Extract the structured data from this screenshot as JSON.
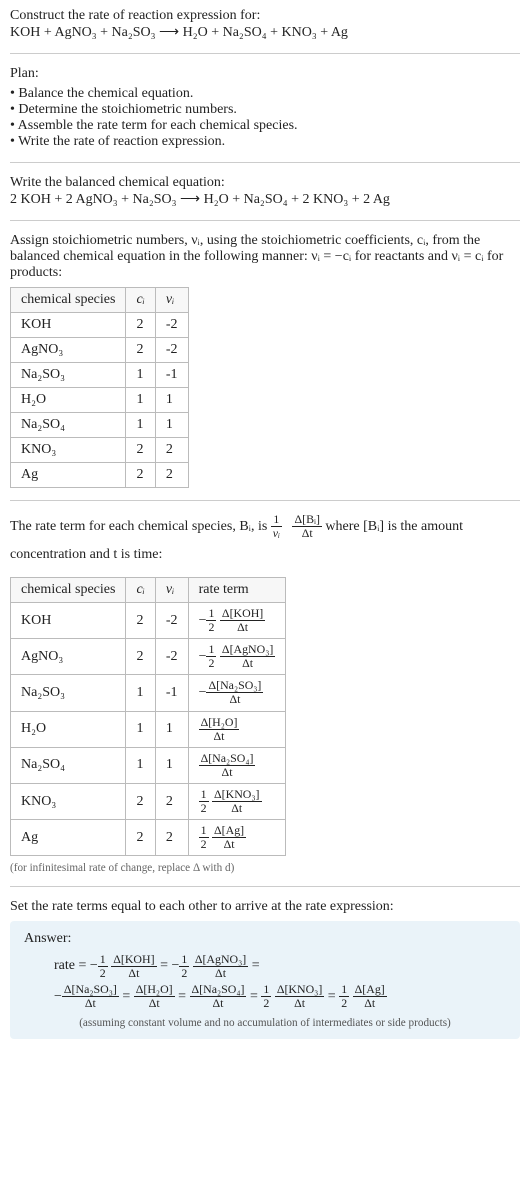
{
  "header": {
    "construct_label": "Construct the rate of reaction expression for:",
    "unbalanced": "KOH + AgNO₃ + Na₂SO₃  ⟶  H₂O + Na₂SO₄ + KNO₃ + Ag"
  },
  "plan": {
    "label": "Plan:",
    "items": [
      "Balance the chemical equation.",
      "Determine the stoichiometric numbers.",
      "Assemble the rate term for each chemical species.",
      "Write the rate of reaction expression."
    ]
  },
  "balanced": {
    "label": "Write the balanced chemical equation:",
    "equation": "2 KOH + 2 AgNO₃ + Na₂SO₃  ⟶  H₂O + Na₂SO₄ + 2 KNO₃ + 2 Ag"
  },
  "assign": {
    "text1": "Assign stoichiometric numbers, νᵢ, using the stoichiometric coefficients, cᵢ, from the balanced chemical equation in the following manner: νᵢ = −cᵢ for reactants and νᵢ = cᵢ for products:",
    "table_headers": [
      "chemical species",
      "cᵢ",
      "νᵢ"
    ],
    "rows": [
      {
        "species": "KOH",
        "c": "2",
        "v": "-2"
      },
      {
        "species": "AgNO₃",
        "c": "2",
        "v": "-2"
      },
      {
        "species": "Na₂SO₃",
        "c": "1",
        "v": "-1"
      },
      {
        "species": "H₂O",
        "c": "1",
        "v": "1"
      },
      {
        "species": "Na₂SO₄",
        "c": "1",
        "v": "1"
      },
      {
        "species": "KNO₃",
        "c": "2",
        "v": "2"
      },
      {
        "species": "Ag",
        "c": "2",
        "v": "2"
      }
    ]
  },
  "rateterm": {
    "text_a": "The rate term for each chemical species, Bᵢ, is ",
    "text_b": " where [Bᵢ] is the amount concentration and t is time:",
    "frac_outer_num": "1",
    "frac_outer_den": "νᵢ",
    "frac_inner_num": "Δ[Bᵢ]",
    "frac_inner_den": "Δt",
    "table_headers": [
      "chemical species",
      "cᵢ",
      "νᵢ",
      "rate term"
    ],
    "rows": [
      {
        "species": "KOH",
        "c": "2",
        "v": "-2",
        "coef": "−½",
        "num": "Δ[KOH]",
        "den": "Δt"
      },
      {
        "species": "AgNO₃",
        "c": "2",
        "v": "-2",
        "coef": "−½",
        "num": "Δ[AgNO₃]",
        "den": "Δt"
      },
      {
        "species": "Na₂SO₃",
        "c": "1",
        "v": "-1",
        "coef": "−",
        "num": "Δ[Na₂SO₃]",
        "den": "Δt"
      },
      {
        "species": "H₂O",
        "c": "1",
        "v": "1",
        "coef": "",
        "num": "Δ[H₂O]",
        "den": "Δt"
      },
      {
        "species": "Na₂SO₄",
        "c": "1",
        "v": "1",
        "coef": "",
        "num": "Δ[Na₂SO₄]",
        "den": "Δt"
      },
      {
        "species": "KNO₃",
        "c": "2",
        "v": "2",
        "coef": "½",
        "num": "Δ[KNO₃]",
        "den": "Δt"
      },
      {
        "species": "Ag",
        "c": "2",
        "v": "2",
        "coef": "½",
        "num": "Δ[Ag]",
        "den": "Δt"
      }
    ],
    "note": "(for infinitesimal rate of change, replace Δ with d)"
  },
  "final": {
    "label": "Set the rate terms equal to each other to arrive at the rate expression:",
    "answer_label": "Answer:",
    "rate_prefix": "rate = ",
    "note": "(assuming constant volume and no accumulation of intermediates or side products)"
  },
  "chart_data": {
    "type": "table",
    "title": "Stoichiometric numbers and rate terms",
    "tables": [
      {
        "name": "stoichiometric_numbers",
        "columns": [
          "chemical species",
          "c_i",
          "nu_i"
        ],
        "rows": [
          [
            "KOH",
            2,
            -2
          ],
          [
            "AgNO3",
            2,
            -2
          ],
          [
            "Na2SO3",
            1,
            -1
          ],
          [
            "H2O",
            1,
            1
          ],
          [
            "Na2SO4",
            1,
            1
          ],
          [
            "KNO3",
            2,
            2
          ],
          [
            "Ag",
            2,
            2
          ]
        ]
      },
      {
        "name": "rate_terms",
        "columns": [
          "chemical species",
          "c_i",
          "nu_i",
          "rate term"
        ],
        "rows": [
          [
            "KOH",
            2,
            -2,
            "-(1/2) d[KOH]/dt"
          ],
          [
            "AgNO3",
            2,
            -2,
            "-(1/2) d[AgNO3]/dt"
          ],
          [
            "Na2SO3",
            1,
            -1,
            "- d[Na2SO3]/dt"
          ],
          [
            "H2O",
            1,
            1,
            "d[H2O]/dt"
          ],
          [
            "Na2SO4",
            1,
            1,
            "d[Na2SO4]/dt"
          ],
          [
            "KNO3",
            2,
            2,
            "(1/2) d[KNO3]/dt"
          ],
          [
            "Ag",
            2,
            2,
            "(1/2) d[Ag]/dt"
          ]
        ]
      }
    ],
    "rate_expression": "rate = -(1/2) d[KOH]/dt = -(1/2) d[AgNO3]/dt = - d[Na2SO3]/dt = d[H2O]/dt = d[Na2SO4]/dt = (1/2) d[KNO3]/dt = (1/2) d[Ag]/dt"
  }
}
